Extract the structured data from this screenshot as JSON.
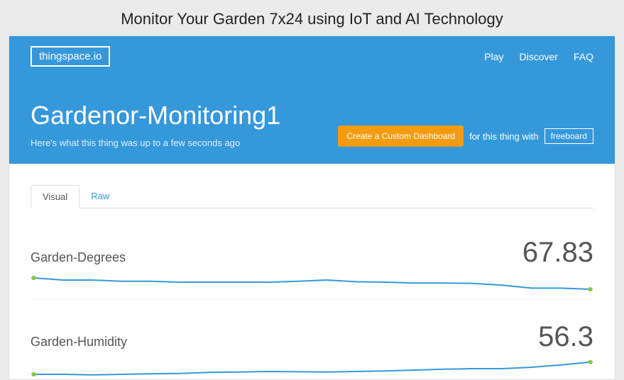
{
  "page_heading": "Monitor Your Garden 7x24 using IoT and AI Technology",
  "brand": "thingspace.io",
  "nav": {
    "play": "Play",
    "discover": "Discover",
    "faq": "FAQ"
  },
  "dashboard": {
    "title": "Gardenor-Monitoring1",
    "subtitle": "Here's what this thing was up to a few seconds ago",
    "cta_button": "Create a Custom Dashboard",
    "cta_text": "for this thing with",
    "freeboard": "freeboard"
  },
  "tabs": {
    "visual": "Visual",
    "raw": "Raw"
  },
  "metrics": {
    "degrees": {
      "label": "Garden-Degrees",
      "value": "67.83"
    },
    "humidity": {
      "label": "Garden-Humidity",
      "value": "56.3"
    }
  },
  "chart_data": [
    {
      "type": "line",
      "title": "Garden-Degrees",
      "latest": 67.83,
      "x": [
        0,
        1,
        2,
        3,
        4,
        5,
        6,
        7,
        8,
        9,
        10,
        11,
        12,
        13,
        14,
        15,
        16,
        17,
        18,
        19
      ],
      "values": [
        70.5,
        70.0,
        70.0,
        69.7,
        69.7,
        69.5,
        69.5,
        69.5,
        69.5,
        69.7,
        70.0,
        69.6,
        69.5,
        69.3,
        69.3,
        69.2,
        68.8,
        68.1,
        68.1,
        67.83
      ],
      "ylim": [
        67,
        71
      ],
      "xlabel": "",
      "ylabel": ""
    },
    {
      "type": "line",
      "title": "Garden-Humidity",
      "latest": 56.3,
      "x": [
        0,
        1,
        2,
        3,
        4,
        5,
        6,
        7,
        8,
        9,
        10,
        11,
        12,
        13,
        14,
        15,
        16,
        17,
        18,
        19
      ],
      "values": [
        52.0,
        52.0,
        51.8,
        52.0,
        52.2,
        52.3,
        52.7,
        52.8,
        53.0,
        52.9,
        52.8,
        53.0,
        53.2,
        53.5,
        53.8,
        54.0,
        54.0,
        54.5,
        55.3,
        56.3
      ],
      "ylim": [
        51,
        57
      ],
      "xlabel": "",
      "ylabel": ""
    }
  ]
}
